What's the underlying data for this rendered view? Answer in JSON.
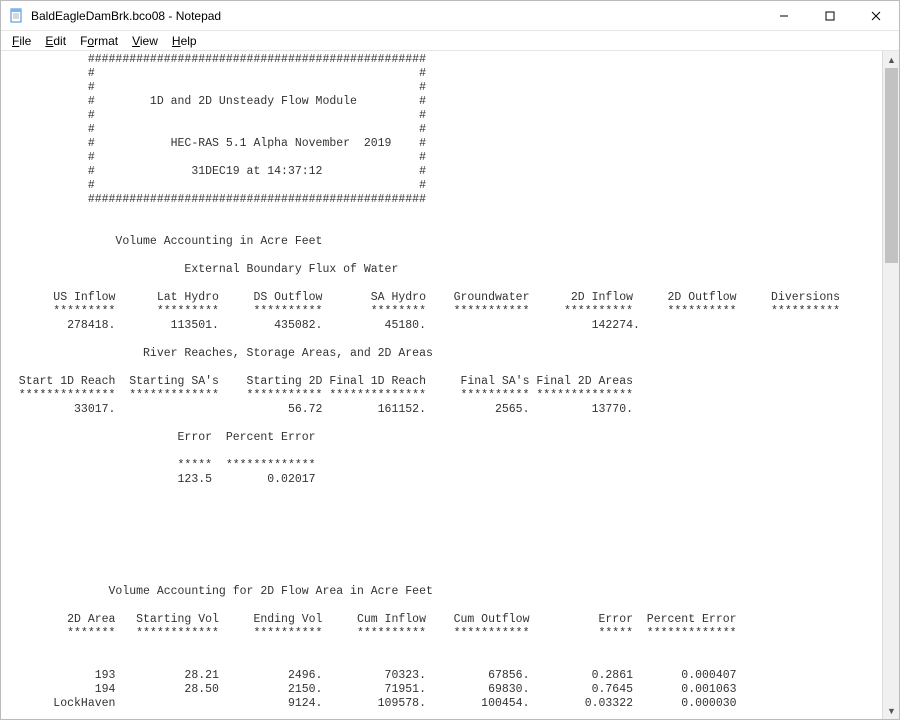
{
  "titlebar": {
    "title": "BaldEagleDamBrk.bco08 - Notepad"
  },
  "menubar": {
    "file": "File",
    "edit": "Edit",
    "format": "Format",
    "view": "View",
    "help": "Help"
  },
  "text": {
    "banner_hash_full": "            #################################################",
    "banner_hash_blank": "            #                                               #",
    "banner_hash_module": "            #        1D and 2D Unsteady Flow Module         #",
    "banner_hash_ver": "            #           HEC-RAS 5.1 Alpha November  2019    #",
    "banner_hash_date": "            #              31DEC19 at 14:37:12              #",
    "blank": "",
    "vol_acct_hdr": "                Volume Accounting in Acre Feet",
    "ext_boundary_hdr": "                          External Boundary Flux of Water",
    "ext_cols": "       US Inflow      Lat Hydro     DS Outflow       SA Hydro    Groundwater      2D Inflow     2D Outflow     Diversions",
    "ext_stars": "       *********      *********     **********       ********    ***********     **********     **********     **********",
    "ext_values": "         278418.        113501.        435082.         45180.                        142274.",
    "reaches_hdr": "                    River Reaches, Storage Areas, and 2D Areas",
    "reach_cols": "  Start 1D Reach  Starting SA's    Starting 2D Final 1D Reach     Final SA's Final 2D Areas",
    "reach_stars": "  **************  *************    *********** **************     ********** **************",
    "reach_values": "          33017.                         56.72        161152.          2565.         13770.",
    "err_hdr": "                         Error  Percent Error",
    "err_stars": "                         *****  *************",
    "err_values": "                         123.5        0.02017",
    "vol2d_hdr": "               Volume Accounting for 2D Flow Area in Acre Feet",
    "vol2d_cols": "         2D Area   Starting Vol     Ending Vol     Cum Inflow    Cum Outflow          Error  Percent Error",
    "vol2d_stars": "         *******   ************     **********     **********    ***********          *****  *************",
    "vol2d_row1": "             193          28.21          2496.         70323.         67856.         0.2861       0.000407",
    "vol2d_row2": "             194          28.50          2150.         71951.         69830.         0.7645       0.001063",
    "vol2d_row3": "       LockHaven                         9124.        109578.        100454.        0.03322       0.000030"
  }
}
